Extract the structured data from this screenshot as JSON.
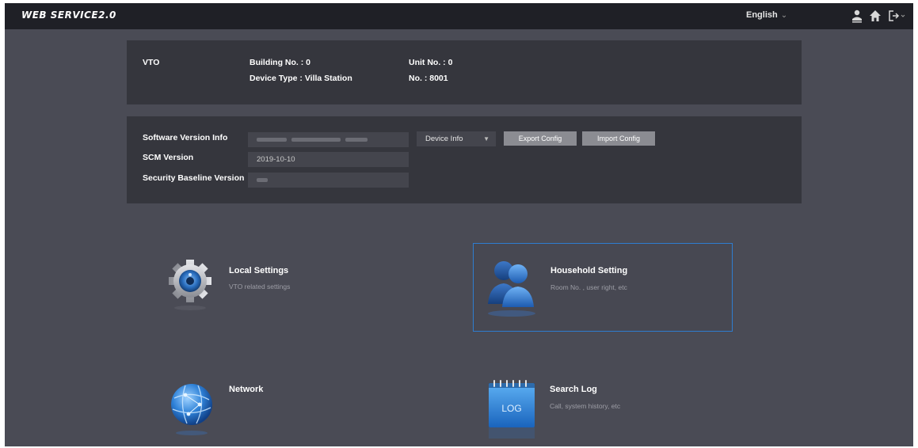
{
  "header": {
    "logo_text": "WEB SERVICE2.0",
    "language": "English",
    "icons": [
      "user-icon",
      "home-icon",
      "logout-icon"
    ]
  },
  "device": {
    "model": "VTO",
    "building_no": "Building No. : 0",
    "device_type": "Device Type : Villa Station",
    "unit_no": "Unit No. : 0",
    "no": "No. : 8001"
  },
  "versions": {
    "software_label": "Software Version Info",
    "scm_label": "SCM Version",
    "scm_value": "2019-10-10",
    "baseline_label": "Security Baseline Version",
    "device_info_select": "Device Info",
    "export_label": "Export Config",
    "import_label": "Import Config"
  },
  "tiles": [
    {
      "title": "Local Settings",
      "subtitle": "VTO related settings",
      "icon": "gear-icon",
      "selected": false
    },
    {
      "title": "Household Setting",
      "subtitle": "Room No. , user right, etc",
      "icon": "users-icon",
      "selected": true
    },
    {
      "title": "Network",
      "subtitle": "",
      "icon": "globe-icon",
      "selected": false
    },
    {
      "title": "Search Log",
      "subtitle": "Call, system history, etc",
      "icon": "log-icon",
      "icon_text": "LOG",
      "selected": false
    }
  ],
  "colors": {
    "background": "#4a4b55",
    "topbar": "#1f2026",
    "panel": "#35363d",
    "accent": "#2e7dd0"
  }
}
